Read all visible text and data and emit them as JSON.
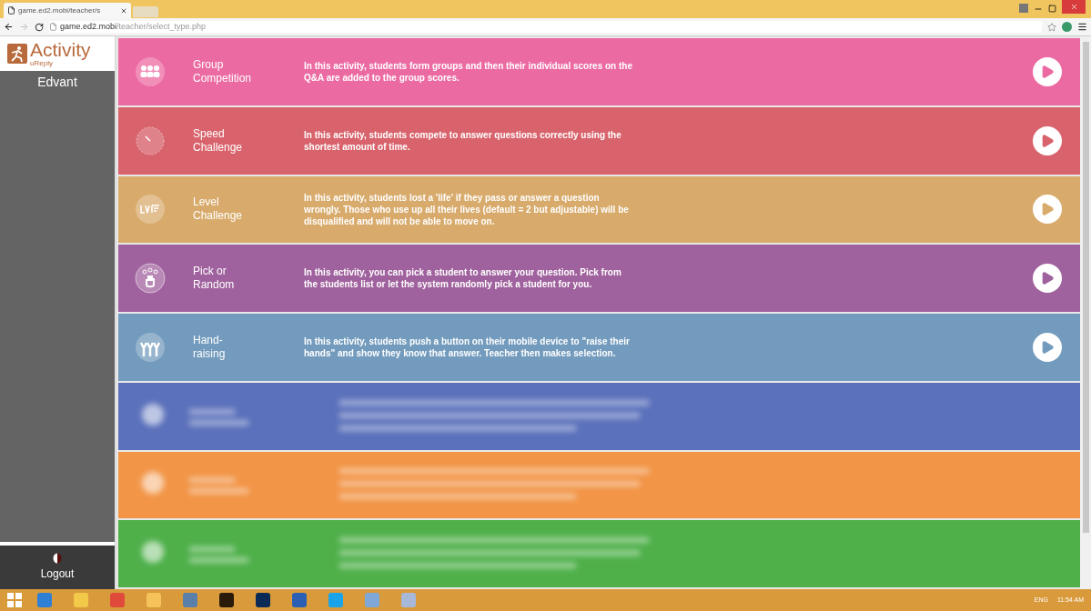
{
  "browser": {
    "tab_title": "game.ed2.mobi/teacher/s",
    "url_host": "game.ed2.mobi",
    "url_path": "/teacher/select_type.php"
  },
  "sidebar": {
    "logo_title": "Activity",
    "logo_subtitle": "uReply",
    "user": "Edvant",
    "logout": "Logout"
  },
  "activities": [
    {
      "kind": "activity",
      "name": "Group\nCompetition",
      "description": "In this activity, students form groups and then their individual scores on the Q&A are added to the group scores.",
      "color": "#ec6aa2"
    },
    {
      "kind": "activity",
      "name": "Speed\nChallenge",
      "description": "In this activity, students compete to answer questions correctly using the shortest amount of time.",
      "color": "#d9636c"
    },
    {
      "kind": "activity",
      "name": "Level\nChallenge",
      "description": "In this activity, students lost a 'life' if they pass or answer a question wrongly. Those who use up all their lives (default = 2 but adjustable) will be disqualified and will not be able to move on.",
      "color": "#d8ab6c"
    },
    {
      "kind": "activity",
      "name": "Pick or\nRandom",
      "description": "In this activity, you can pick a student to answer your question. Pick from the students list or let the system randomly pick a student for you.",
      "color": "#a0629e"
    },
    {
      "kind": "activity",
      "name": "Hand-\nraising",
      "description": "In this activity, students push a button on their mobile device to \"raise their hands\" and show they know that answer. Teacher then makes selection.",
      "color": "#739bbd"
    },
    {
      "kind": "blurred",
      "color": "#5b71bb"
    },
    {
      "kind": "blurred",
      "color": "#f29547"
    },
    {
      "kind": "blurred",
      "color": "#4fb04a"
    }
  ],
  "taskbar": {
    "language": "ENG",
    "time": "11:54 AM"
  }
}
